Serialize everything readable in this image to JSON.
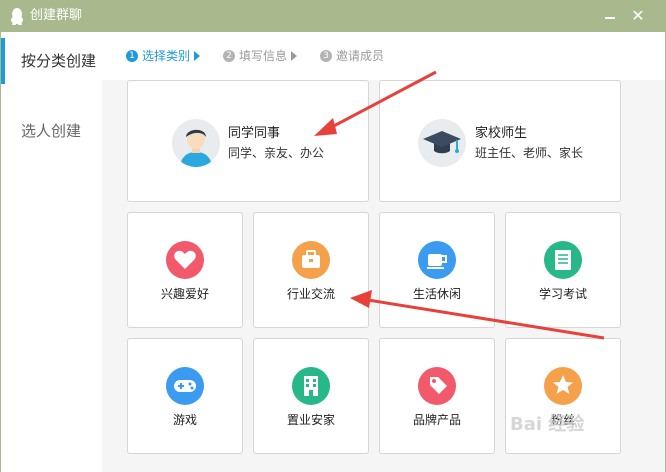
{
  "window": {
    "title": "创建群聊"
  },
  "nav": {
    "items": [
      {
        "label": "按分类创建"
      },
      {
        "label": "选人创建"
      }
    ]
  },
  "steps": [
    {
      "num": "1",
      "label": "选择类别"
    },
    {
      "num": "2",
      "label": "填写信息"
    },
    {
      "num": "3",
      "label": "邀请成员"
    }
  ],
  "categories_big": [
    {
      "title": "同学同事",
      "subtitle": "同学、亲友、办公",
      "icon": "student-avatar-icon"
    },
    {
      "title": "家校师生",
      "subtitle": "班主任、老师、家长",
      "icon": "graduation-cap-icon"
    }
  ],
  "categories_small": [
    {
      "label": "兴趣爱好",
      "icon": "heart-icon",
      "color": "#f25a6b"
    },
    {
      "label": "行业交流",
      "icon": "briefcase-icon",
      "color": "#f5a04b"
    },
    {
      "label": "生活休闲",
      "icon": "coffee-cup-icon",
      "color": "#3a9bf0"
    },
    {
      "label": "学习考试",
      "icon": "notebook-icon",
      "color": "#28b789"
    },
    {
      "label": "游戏",
      "icon": "gamepad-icon",
      "color": "#3a9bf0"
    },
    {
      "label": "置业安家",
      "icon": "building-icon",
      "color": "#28b789"
    },
    {
      "label": "品牌产品",
      "icon": "price-tag-icon",
      "color": "#f25a6b"
    },
    {
      "label": "粉丝",
      "icon": "star-icon",
      "color": "#f5a04b"
    }
  ],
  "watermark": {
    "text": "Bai 经验"
  },
  "colors": {
    "titlebar": "#a7b98d",
    "accent": "#1f9bd7",
    "annotation": "#e8413a"
  }
}
